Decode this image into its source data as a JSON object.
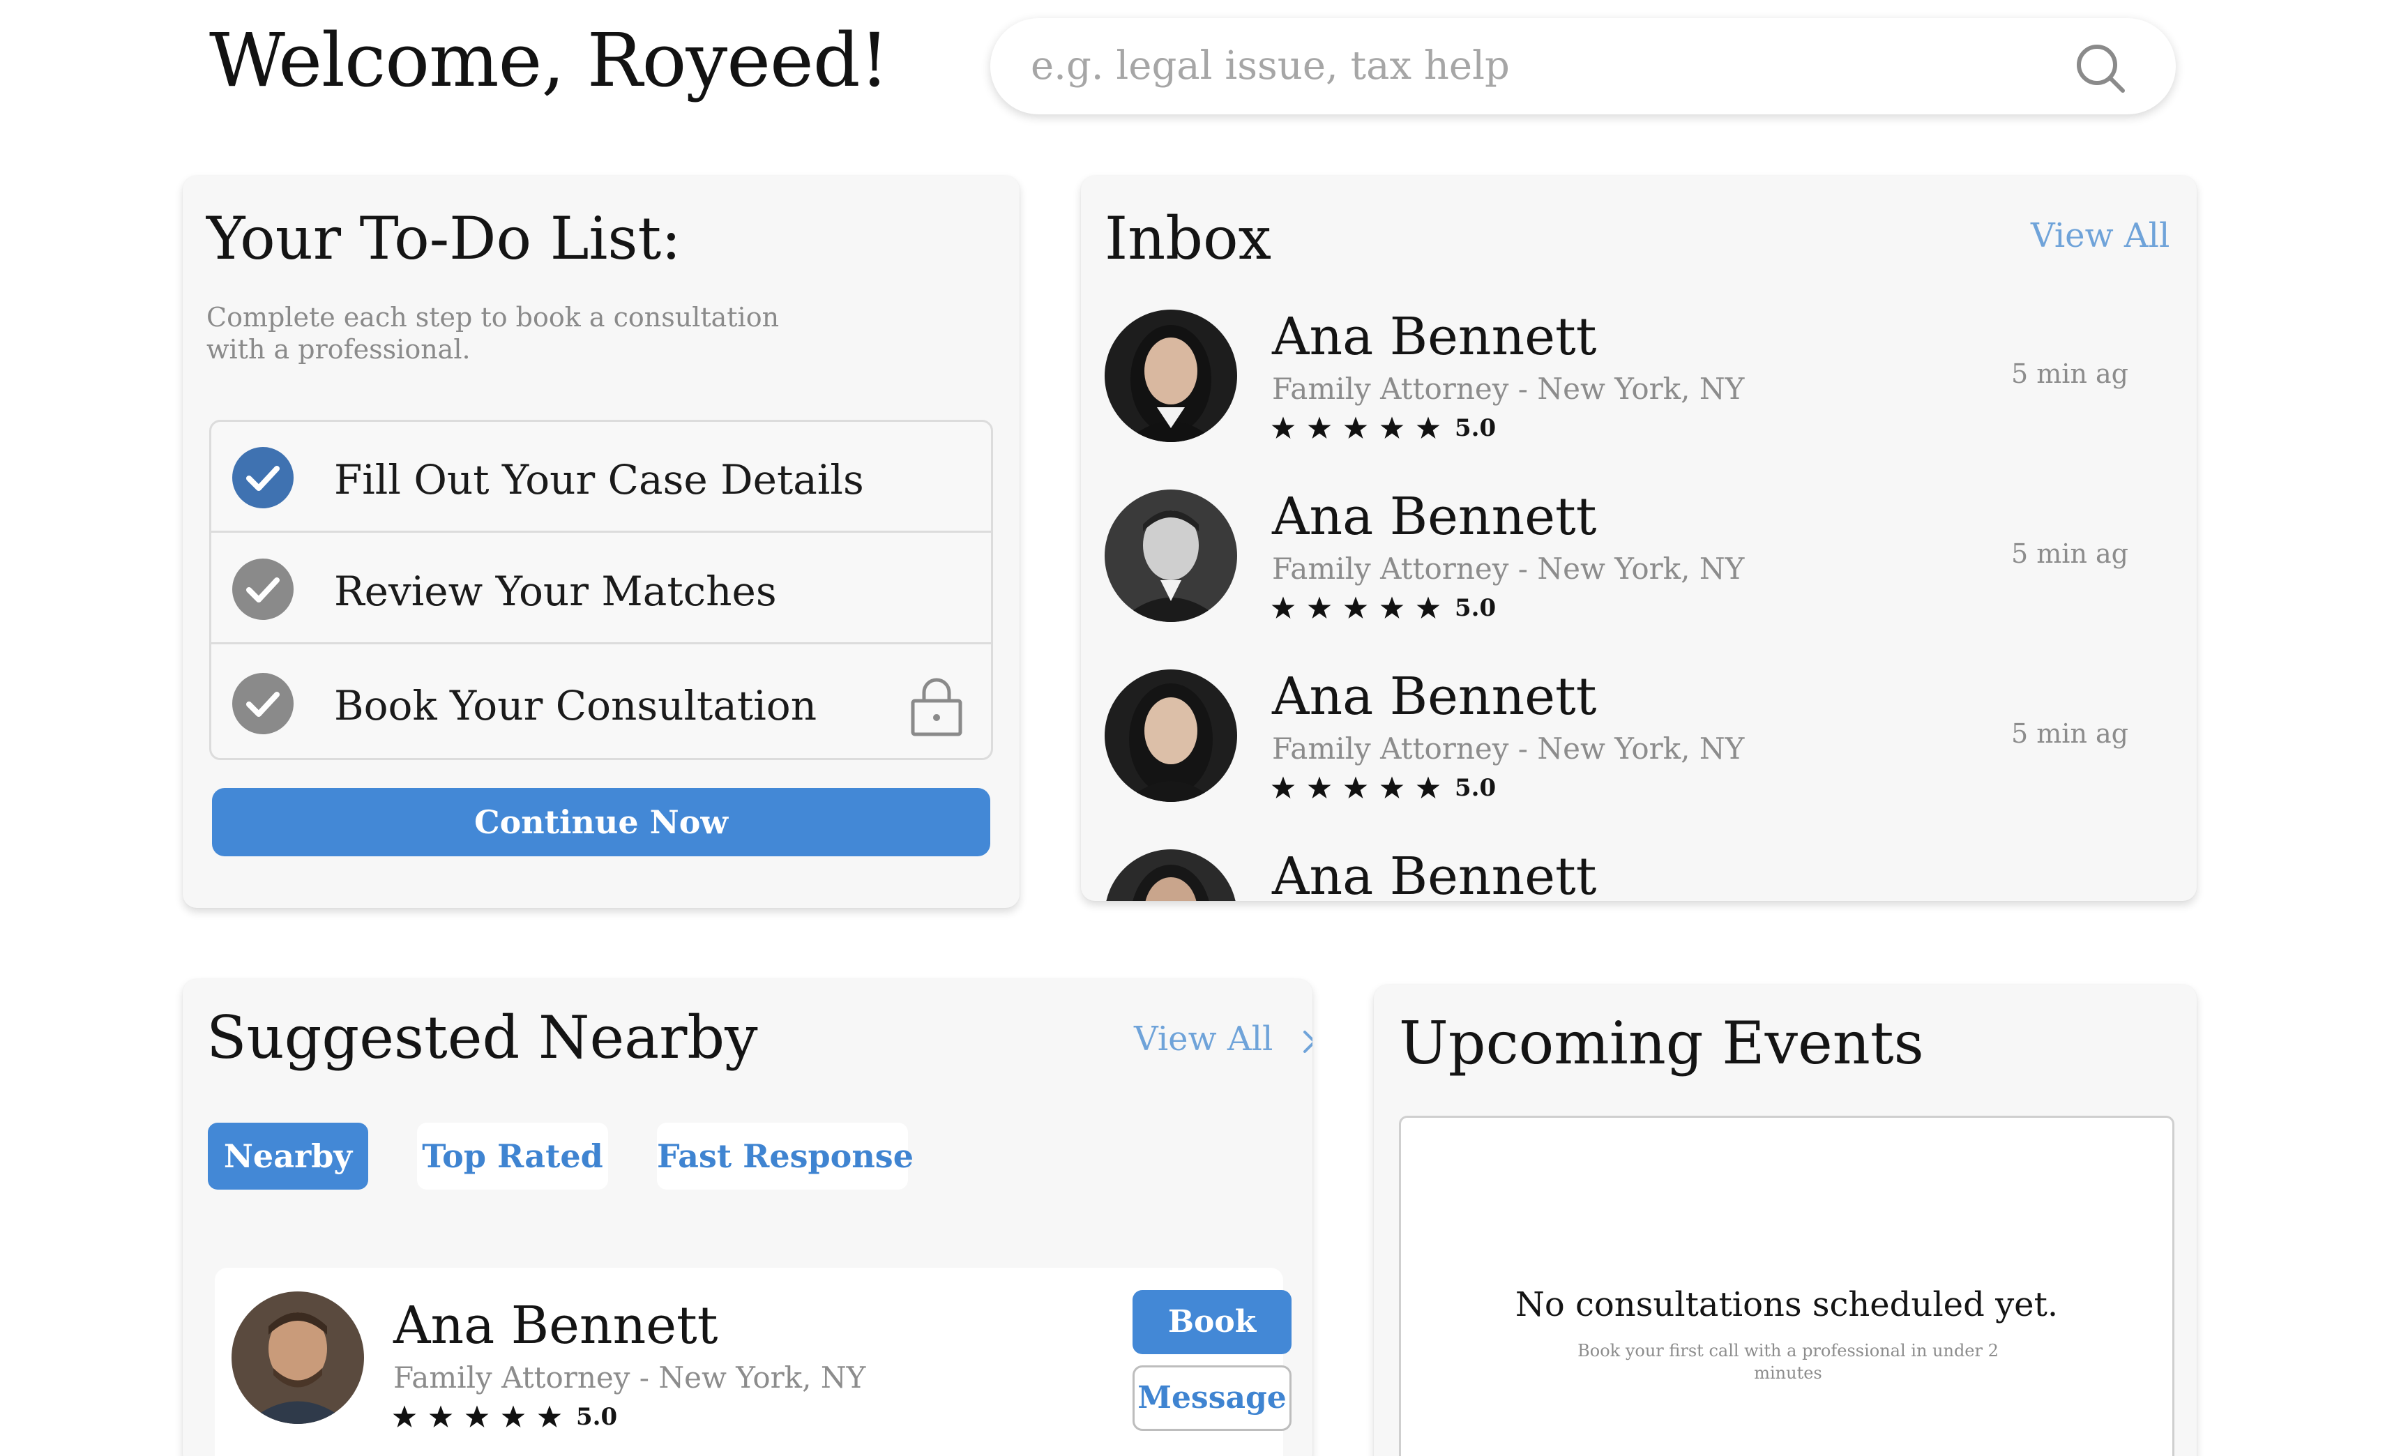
{
  "header": {
    "welcome": "Welcome, Royeed!",
    "search_placeholder": "e.g. legal issue, tax help",
    "search_icon": "search-icon"
  },
  "todo": {
    "title": "Your To-Do List:",
    "description": "Complete each step to book a consultation with a professional.",
    "items": [
      {
        "label": "Fill Out Your Case Details",
        "status": "completed",
        "color": "#3f72b1"
      },
      {
        "label": "Review Your Matches",
        "status": "checked",
        "color": "#8a8a8a"
      },
      {
        "label": "Book Your Consultation",
        "status": "locked",
        "color": "#8a8a8a"
      }
    ],
    "continue_label": "Continue Now"
  },
  "inbox": {
    "title": "Inbox",
    "view_all": "View All",
    "messages": [
      {
        "name": "Ana Bennett",
        "role": "Family Attorney - New York, NY",
        "rating": "5.0",
        "stars": 5,
        "time": "5 min ag"
      },
      {
        "name": "Ana Bennett",
        "role": "Family Attorney - New York, NY",
        "rating": "5.0",
        "stars": 5,
        "time": "5 min ag"
      },
      {
        "name": "Ana Bennett",
        "role": "Family Attorney - New York, NY",
        "rating": "5.0",
        "stars": 5,
        "time": "5 min ag"
      },
      {
        "name": "Ana Bennett"
      }
    ]
  },
  "suggested": {
    "title": "Suggested Nearby",
    "view_all": "View All",
    "tabs": [
      {
        "label": "Nearby",
        "active": true
      },
      {
        "label": "Top Rated",
        "active": false
      },
      {
        "label": "Fast Response",
        "active": false
      }
    ],
    "pro": {
      "name": "Ana Bennett",
      "role": "Family Attorney - New York, NY",
      "rating": "5.0",
      "stars": 5,
      "book_label": "Book",
      "message_label": "Message"
    }
  },
  "events": {
    "title": "Upcoming Events",
    "empty_title": "No consultations scheduled yet.",
    "empty_subtitle": "Book your first call with a professional in under 2 minutes"
  },
  "colors": {
    "accent": "#4388d6",
    "link": "#6fa3d9",
    "muted": "#8c8c8c",
    "card_bg": "#f7f7f7"
  }
}
